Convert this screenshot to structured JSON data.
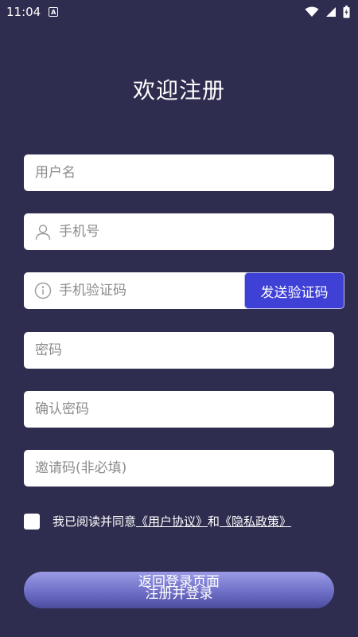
{
  "status_bar": {
    "time": "11:04",
    "notification_icon": "a-icon",
    "wifi_icon": "wifi-icon",
    "signal_icon": "signal-icon",
    "battery_icon": "battery-icon"
  },
  "page": {
    "title": "欢迎注册"
  },
  "form": {
    "username": {
      "placeholder": "用户名",
      "value": ""
    },
    "phone": {
      "placeholder": "手机号",
      "value": "",
      "icon": "user-icon"
    },
    "sms_code": {
      "placeholder": "手机验证码",
      "value": "",
      "icon": "info-icon",
      "send_label": "发送验证码"
    },
    "password": {
      "placeholder": "密码",
      "value": ""
    },
    "confirm_password": {
      "placeholder": "确认密码",
      "value": ""
    },
    "invite_code": {
      "placeholder": "邀请码(非必填)",
      "value": ""
    }
  },
  "agreement": {
    "prefix": "我已阅读并同意",
    "user_agreement": "《用户协议》",
    "and": "和",
    "privacy_policy": "《隐私政策》",
    "checked": false
  },
  "actions": {
    "submit_label": "注册并登录",
    "back_label": "返回登录页面"
  },
  "colors": {
    "background": "#2e2d4f",
    "accent": "#3f41d6"
  }
}
